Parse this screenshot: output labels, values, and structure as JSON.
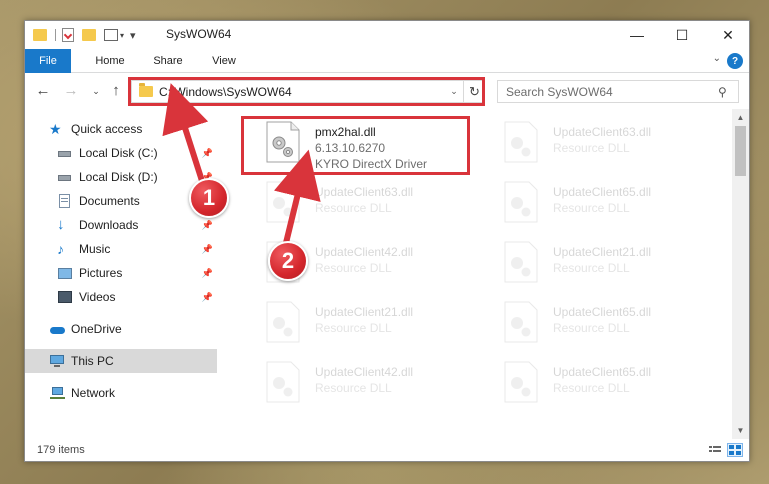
{
  "window": {
    "title": "SysWOW64",
    "minimize": "—",
    "maximize": "☐",
    "close": "✕"
  },
  "ribbon": {
    "tabs": [
      "File",
      "Home",
      "Share",
      "View"
    ],
    "help": "?"
  },
  "nav": {
    "address": "C:\\Windows\\SysWOW64",
    "search_placeholder": "Search SysWOW64"
  },
  "sidebar": {
    "items": [
      {
        "label": "Quick access",
        "icon": "star-icon"
      },
      {
        "label": "Local Disk (C:)",
        "icon": "drive-icon",
        "pinned": true
      },
      {
        "label": "Local Disk (D:)",
        "icon": "drive-icon",
        "pinned": true
      },
      {
        "label": "Documents",
        "icon": "documents-icon",
        "pinned": true
      },
      {
        "label": "Downloads",
        "icon": "downloads-icon",
        "pinned": true
      },
      {
        "label": "Music",
        "icon": "music-icon",
        "pinned": true
      },
      {
        "label": "Pictures",
        "icon": "pictures-icon",
        "pinned": true
      },
      {
        "label": "Videos",
        "icon": "videos-icon",
        "pinned": true
      },
      {
        "label": "OneDrive",
        "icon": "cloud-icon"
      },
      {
        "label": "This PC",
        "icon": "computer-icon"
      },
      {
        "label": "Network",
        "icon": "network-icon"
      }
    ]
  },
  "files": {
    "main": {
      "name": "pmx2hal.dll",
      "version": "6.13.10.6270",
      "description": "KYRO DirectX Driver"
    },
    "faded": [
      {
        "name": "UpdateClient63.dll",
        "description": "Resource DLL"
      },
      {
        "name": "UpdateClient63.dll",
        "description": "Resource DLL"
      },
      {
        "name": "UpdateClient65.dll",
        "description": "Resource DLL"
      },
      {
        "name": "UpdateClient42.dll",
        "description": "Resource DLL"
      },
      {
        "name": "UpdateClient21.dll",
        "description": "Resource DLL"
      },
      {
        "name": "UpdateClient21.dll",
        "description": "Resource DLL"
      },
      {
        "name": "UpdateClient65.dll",
        "description": "Resource DLL"
      },
      {
        "name": "UpdateClient42.dll",
        "description": "Resource DLL"
      },
      {
        "name": "UpdateClient65.dll",
        "description": "Resource DLL"
      }
    ]
  },
  "status": {
    "item_count": "179 items"
  },
  "annotations": {
    "step1": "1",
    "step2": "2",
    "color": "#d9343b"
  }
}
